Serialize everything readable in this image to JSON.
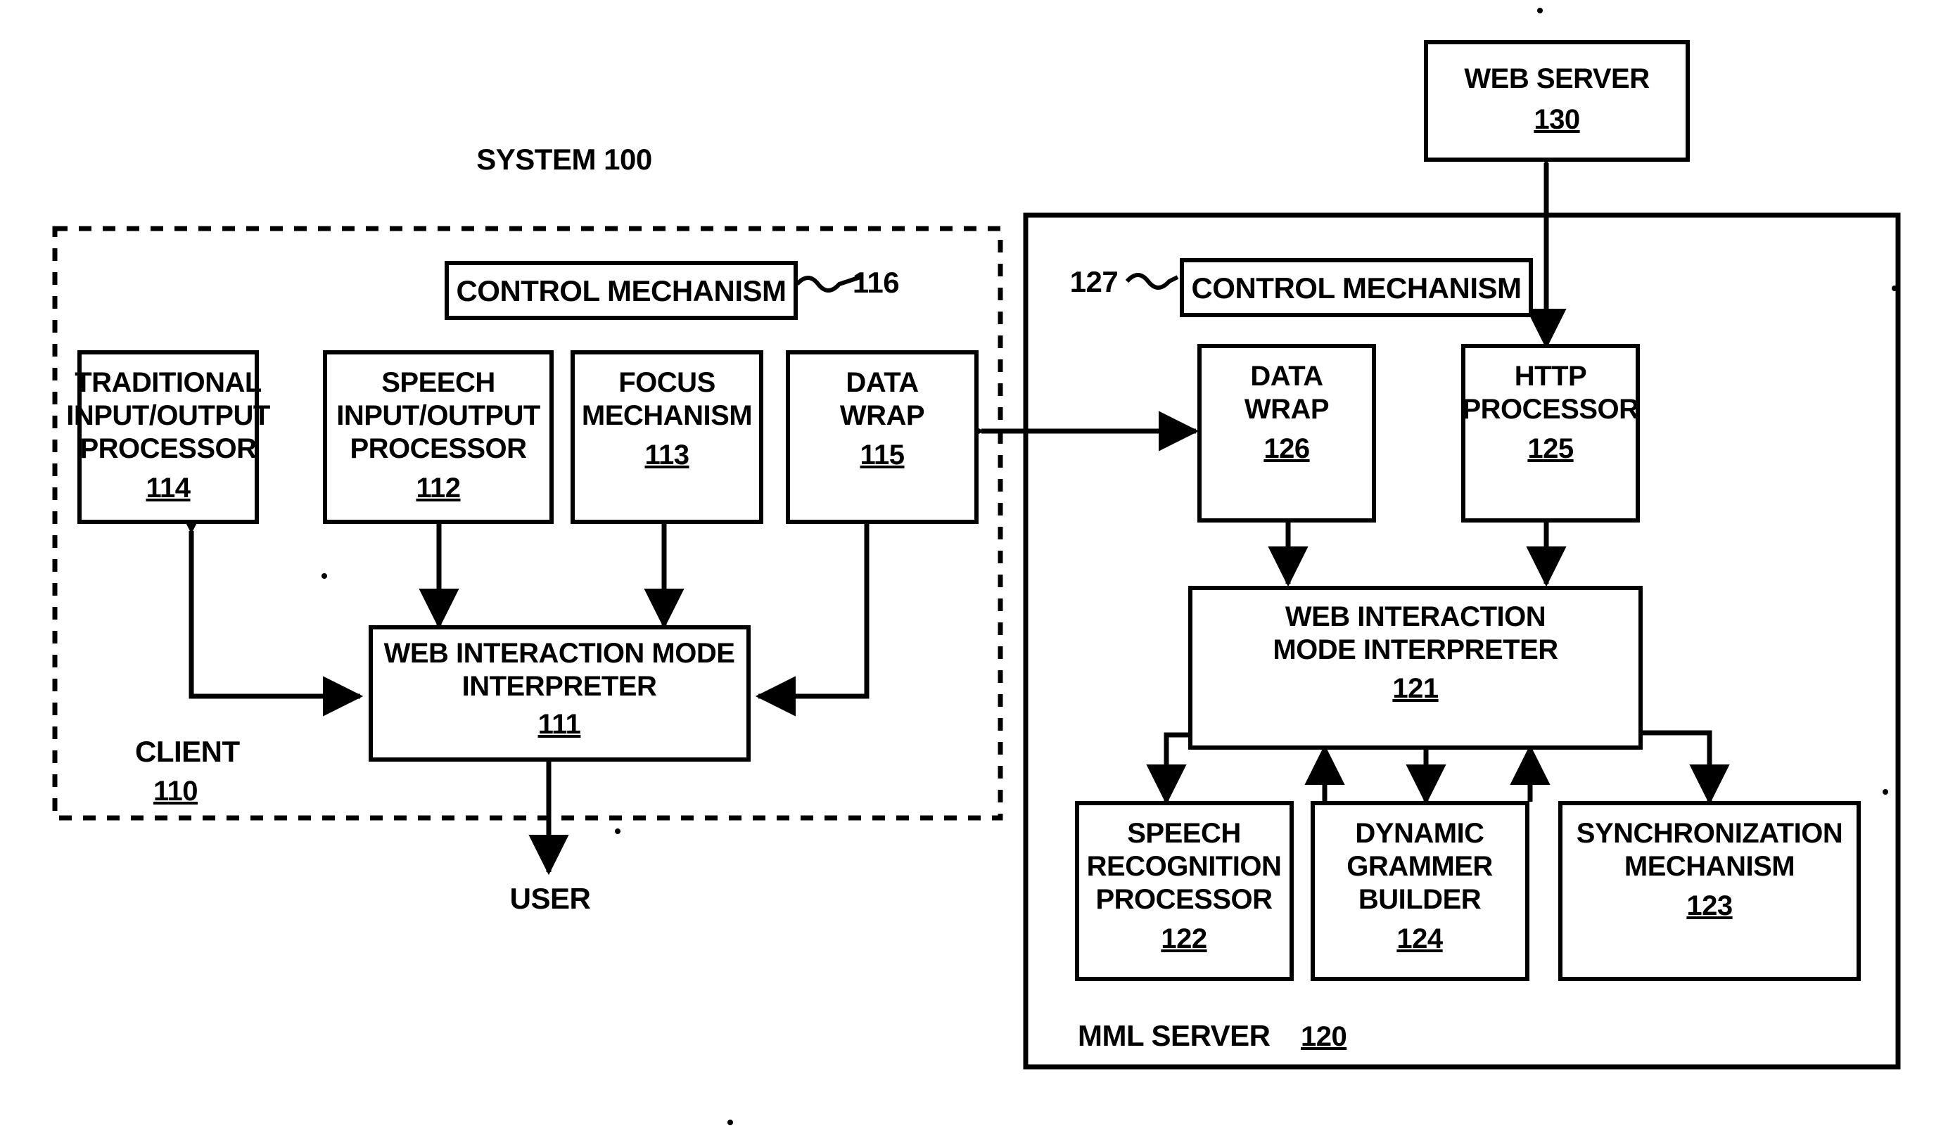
{
  "figure": {
    "title": "SYSTEM 100",
    "user_label": "USER",
    "client_label": "CLIENT",
    "client_number": "110",
    "server_label": "MML SERVER",
    "server_number": "120"
  },
  "client": {
    "control_mechanism": {
      "label": "CONTROL MECHANISM",
      "ref": "116"
    },
    "boxes": [
      {
        "id": "traditional-io-processor",
        "lines": [
          "TRADITIONAL",
          "INPUT/OUTPUT",
          "PROCESSOR"
        ],
        "number": "114"
      },
      {
        "id": "speech-io-processor",
        "lines": [
          "SPEECH",
          "INPUT/OUTPUT",
          "PROCESSOR"
        ],
        "number": "112"
      },
      {
        "id": "focus-mechanism",
        "lines": [
          "FOCUS",
          "MECHANISM"
        ],
        "number": "113"
      },
      {
        "id": "data-wrap-client",
        "lines": [
          "DATA",
          "WRAP"
        ],
        "number": "115"
      }
    ],
    "interpreter": {
      "lines": [
        "WEB INTERACTION MODE",
        "INTERPRETER"
      ],
      "number": "111"
    }
  },
  "server": {
    "control_mechanism": {
      "label": "CONTROL MECHANISM",
      "ref": "127"
    },
    "top_boxes": [
      {
        "id": "data-wrap-server",
        "lines": [
          "DATA",
          "WRAP"
        ],
        "number": "126"
      },
      {
        "id": "http-processor",
        "lines": [
          "HTTP",
          "PROCESSOR"
        ],
        "number": "125"
      }
    ],
    "interpreter": {
      "lines": [
        "WEB INTERACTION",
        "MODE INTERPRETER"
      ],
      "number": "121"
    },
    "bottom_boxes": [
      {
        "id": "speech-recognition-processor",
        "lines": [
          "SPEECH",
          "RECOGNITION",
          "PROCESSOR"
        ],
        "number": "122"
      },
      {
        "id": "dynamic-grammer-builder",
        "lines": [
          "DYNAMIC",
          "GRAMMER",
          "BUILDER"
        ],
        "number": "124"
      },
      {
        "id": "synchronization-mechanism",
        "lines": [
          "SYNCHRONIZATION",
          "MECHANISM"
        ],
        "number": "123"
      }
    ]
  },
  "web_server": {
    "label": "WEB SERVER",
    "number": "130"
  },
  "colors": {
    "ink": "#000000",
    "paper": "#ffffff"
  }
}
